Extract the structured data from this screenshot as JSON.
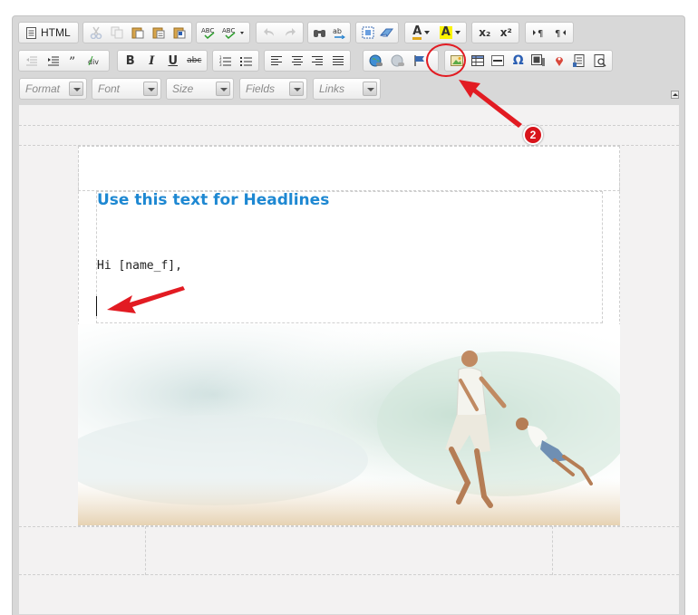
{
  "toolbar": {
    "html_label": "HTML",
    "row1_icons": [
      "source-icon",
      "cut-icon",
      "copy-icon",
      "paste-icon",
      "paste-text-icon",
      "paste-word-icon",
      "spellcheck-icon",
      "spellcheck-dropdown-icon",
      "undo-icon",
      "redo-icon",
      "find-icon",
      "replace-icon",
      "select-all-icon",
      "remove-format-icon",
      "text-color-icon",
      "background-color-icon",
      "subscript-icon",
      "superscript-icon",
      "ltr-icon",
      "rtl-icon"
    ],
    "bold_label": "B",
    "italic_label": "I",
    "underline_label": "U",
    "strike_label": "abc",
    "subscript_label": "x₂",
    "superscript_label": "x²",
    "text_color_label": "A",
    "bg_color_label": "A",
    "omega_label": "Ω"
  },
  "combos": {
    "format": "Format",
    "font": "Font",
    "size": "Size",
    "fields": "Fields",
    "links": "Links"
  },
  "email": {
    "headline": "Use this text for Headlines",
    "greeting": "Hi [name_f],"
  },
  "annotation": {
    "step_number": "2",
    "color": "#e21b22"
  },
  "colors": {
    "headline": "#1e88d2",
    "accent_red": "#d8141b"
  }
}
